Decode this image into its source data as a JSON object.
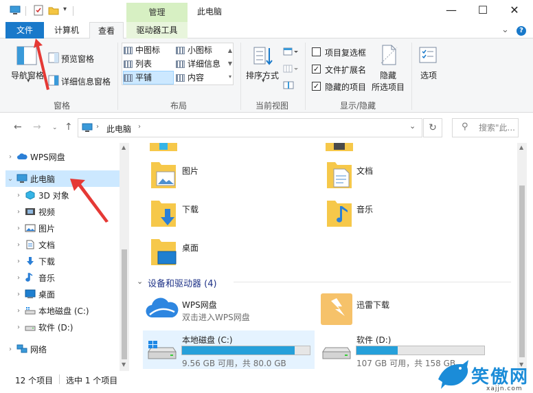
{
  "window": {
    "title": "此电脑",
    "context_tab": "管理",
    "controls": [
      "minimize",
      "maximize",
      "close"
    ]
  },
  "ribbon_tabs": {
    "file": "文件",
    "computer": "计算机",
    "view": "查看",
    "drive_tools": "驱动器工具"
  },
  "ribbon": {
    "pane_group": {
      "label": "窗格",
      "nav_pane": "导航窗格",
      "preview_pane": "预览窗格",
      "details_pane": "详细信息窗格"
    },
    "layout_group": {
      "label": "布局",
      "items": [
        "中图标",
        "小图标",
        "列表",
        "详细信息",
        "平铺",
        "内容"
      ],
      "selected": "平铺"
    },
    "current_view_group": {
      "label": "当前视图",
      "sort_by": "排序方式"
    },
    "show_hide_group": {
      "label": "显示/隐藏",
      "item_checkboxes": "项目复选框",
      "item_checkboxes_checked": false,
      "file_extensions": "文件扩展名",
      "file_extensions_checked": true,
      "hidden_items": "隐藏的项目",
      "hidden_items_checked": true,
      "hide_selected_line1": "隐藏",
      "hide_selected_line2": "所选项目"
    },
    "options": "选项"
  },
  "address": {
    "path": "此电脑",
    "search_placeholder": "搜索\"此..."
  },
  "nav_tree": [
    {
      "label": "WPS网盘",
      "icon": "cloud-icon",
      "level": 0,
      "selected": false
    },
    {
      "label": "此电脑",
      "icon": "computer-icon",
      "level": 0,
      "selected": true,
      "expanded": true
    },
    {
      "label": "3D 对象",
      "icon": "cube-icon",
      "level": 1,
      "selected": false
    },
    {
      "label": "视频",
      "icon": "video-icon",
      "level": 1,
      "selected": false
    },
    {
      "label": "图片",
      "icon": "picture-icon",
      "level": 1,
      "selected": false
    },
    {
      "label": "文档",
      "icon": "document-icon",
      "level": 1,
      "selected": false
    },
    {
      "label": "下载",
      "icon": "download-icon",
      "level": 1,
      "selected": false
    },
    {
      "label": "音乐",
      "icon": "music-icon",
      "level": 1,
      "selected": false
    },
    {
      "label": "桌面",
      "icon": "desktop-icon",
      "level": 1,
      "selected": false
    },
    {
      "label": "本地磁盘 (C:)",
      "icon": "drive-c-icon",
      "level": 1,
      "selected": false
    },
    {
      "label": "软件 (D:)",
      "icon": "drive-icon",
      "level": 1,
      "selected": false
    },
    {
      "label": "网络",
      "icon": "network-icon",
      "level": 0,
      "selected": false
    }
  ],
  "folders": [
    {
      "label": "图片",
      "icon": "pictures-folder-icon"
    },
    {
      "label": "文档",
      "icon": "documents-folder-icon"
    },
    {
      "label": "下载",
      "icon": "downloads-folder-icon"
    },
    {
      "label": "音乐",
      "icon": "music-folder-icon"
    },
    {
      "label": "桌面",
      "icon": "desktop-folder-icon"
    }
  ],
  "devices_section": {
    "title": "设备和驱动器 (4)",
    "items": [
      {
        "label": "WPS网盘",
        "sub": "双击进入WPS网盘",
        "icon": "wps-cloud-icon"
      },
      {
        "label": "迅雷下载",
        "icon": "thunder-icon"
      },
      {
        "label": "本地磁盘 (C:)",
        "sub": "9.56 GB 可用，共 80.0 GB",
        "used_fraction": 0.88,
        "icon": "windows-drive-icon",
        "selected": true
      },
      {
        "label": "软件 (D:)",
        "sub": "107 GB 可用，共 158 GB",
        "used_fraction": 0.32,
        "icon": "drive-icon",
        "selected": false
      }
    ]
  },
  "status": {
    "item_count": "12 个项目",
    "selected_count": "选中 1 个项目"
  },
  "watermark": {
    "text": "笑傲网",
    "sub": "xajjn.com"
  },
  "colors": {
    "accent": "#1979ca",
    "selection": "#cce8ff",
    "progress": "#26a0da",
    "annotation_arrow": "#e53935"
  }
}
